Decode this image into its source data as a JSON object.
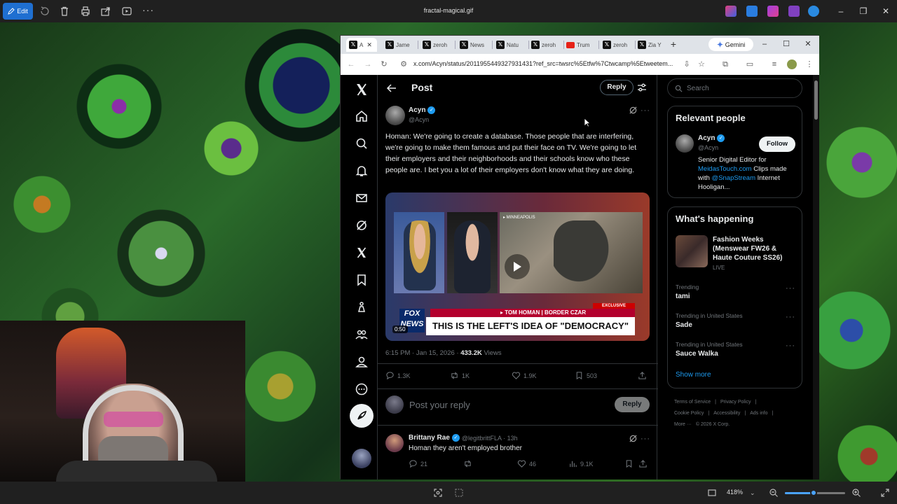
{
  "viewer": {
    "edit_label": "Edit",
    "filename": "fractal-magical.gif",
    "zoom": "418%",
    "zoom_fraction": 0.48,
    "icons": [
      "rotate-icon",
      "delete-icon",
      "print-icon",
      "share-icon",
      "slideshow-icon",
      "more-icon"
    ]
  },
  "browser": {
    "tabs": [
      {
        "icon": "x",
        "label": "A"
      },
      {
        "icon": "x",
        "label": "Jame"
      },
      {
        "icon": "x",
        "label": "zeroh"
      },
      {
        "icon": "x",
        "label": "News"
      },
      {
        "icon": "x",
        "label": "Natu"
      },
      {
        "icon": "x",
        "label": "zeroh"
      },
      {
        "icon": "youtube",
        "label": "Trum"
      },
      {
        "icon": "x",
        "label": "zeroh"
      },
      {
        "icon": "x",
        "label": "Zia Y"
      }
    ],
    "new_tab": "+",
    "gemini_label": "Gemini",
    "url": "x.com/Acyn/status/2011955449327931431?ref_src=twsrc%5Etfw%7Ctwcamp%5Etweetem..."
  },
  "post": {
    "header_title": "Post",
    "reply_top": "Reply",
    "author_name": "Acyn",
    "author_handle": "@Acyn",
    "text": "Homan: We're going to create a database. Those people that are interfering, we're going to make them famous and put their face on TV. We're going to let their employers and their neighborhoods and their schools know who these people are. I bet you a lot of their employers don't know what they are doing.",
    "video": {
      "location": "▸ MINNEAPOLIS",
      "exclusive": "EXCLUSIVE",
      "lower_third": "▸ TOM HOMAN | BORDER CZAR",
      "headline": "THIS IS THE LEFT'S IDEA OF \"DEMOCRACY\"",
      "network": "FOX NEWS",
      "duration": "0:50"
    },
    "timestamp": "6:15 PM · Jan 15, 2026 · ",
    "views_count": "433.2K",
    "views_label": " Views",
    "replies": "1.3K",
    "reposts": "1K",
    "likes": "1.9K",
    "bookmarks": "503",
    "reply_placeholder": "Post your reply",
    "reply_button": "Reply"
  },
  "comment": {
    "name": "Brittany Rae",
    "handle": "@legitbrittFLA · 13h",
    "text": "Homan they aren't employed brother",
    "replies": "21",
    "likes": "46",
    "views": "9.1K"
  },
  "sidebar": {
    "search_placeholder": "Search",
    "relevant_title": "Relevant people",
    "rp_name": "Acyn",
    "rp_handle": "@Acyn",
    "follow_label": "Follow",
    "bio_pre": "Senior Digital Editor for ",
    "bio_link1": "MeidasTouch.com",
    "bio_mid": " Clips made with ",
    "bio_link2": "@SnapStream",
    "bio_post": " Internet Hooligan...",
    "happening_title": "What's happening",
    "featured_title": "Fashion Weeks (Menswear FW26 & Haute Couture SS26)",
    "featured_status": "LIVE",
    "trends": [
      {
        "label": "Trending",
        "name": "tami"
      },
      {
        "label": "Trending in United States",
        "name": "Sade"
      },
      {
        "label": "Trending in United States",
        "name": "Sauce Walka"
      }
    ],
    "show_more": "Show more",
    "footer": [
      "Terms of Service",
      "|",
      "Privacy Policy",
      "|",
      "Cookie Policy",
      "|",
      "Accessibility",
      "|",
      "Ads info",
      "|",
      "More ···",
      "© 2026 X Corp."
    ]
  }
}
